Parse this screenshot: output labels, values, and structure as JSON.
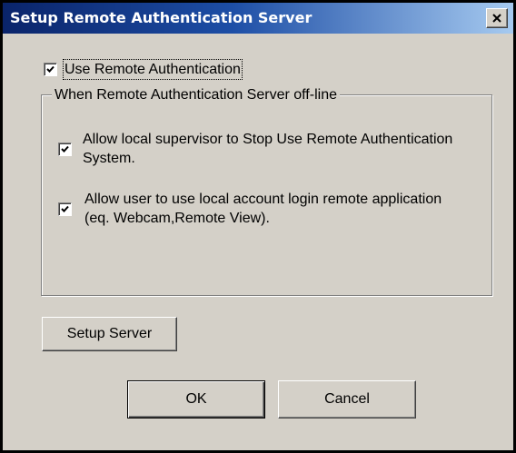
{
  "dialog": {
    "title": "Setup Remote  Authentication Server",
    "close_icon": "close-icon"
  },
  "use_remote": {
    "label": "Use Remote  Authentication",
    "checked": true
  },
  "offline_group": {
    "legend": "When Remote  Authentication Server off-line",
    "options": [
      {
        "label": "Allow local supervisor to Stop Use Remote Authentication System.",
        "checked": true
      },
      {
        "label": "Allow user to use local account login remote application (eq. Webcam,Remote View).",
        "checked": true
      }
    ]
  },
  "buttons": {
    "setup_server": "Setup Server",
    "ok": "OK",
    "cancel": "Cancel"
  }
}
